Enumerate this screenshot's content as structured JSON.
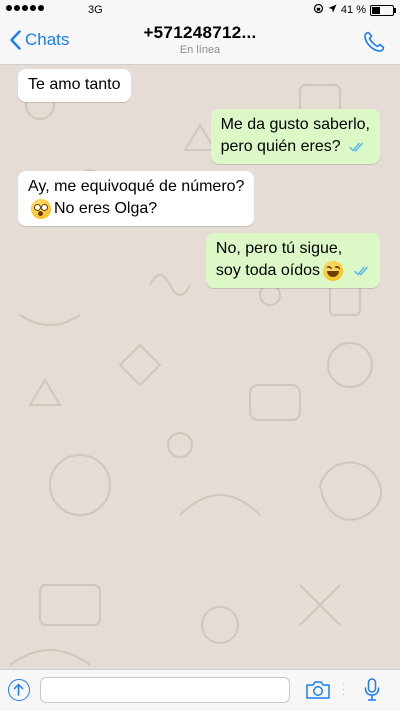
{
  "status_bar": {
    "carrier": "3G",
    "battery": "41 %",
    "battery_level": 0.41
  },
  "header": {
    "back_label": "Chats",
    "contact": "+571248712...",
    "contact_status": "En línea"
  },
  "messages": [
    {
      "direction": "in",
      "lines": [
        "Te amo tanto"
      ]
    },
    {
      "direction": "out",
      "lines": [
        "Me da gusto saberlo,",
        "pero quién eres?"
      ],
      "read": true
    },
    {
      "direction": "in",
      "lines": [
        "Ay, me equivoqué de número?",
        "No eres Olga?"
      ],
      "emoji": "flushed-face"
    },
    {
      "direction": "out",
      "lines": [
        "No, pero tú sigue,",
        "soy toda oídos"
      ],
      "emoji": "laughing-face",
      "read": true
    }
  ],
  "input": {
    "value": "",
    "placeholder": ""
  },
  "colors": {
    "accent": "#1a7cf6",
    "outgoing_bubble": "#dcf8c6",
    "incoming_bubble": "#ffffff",
    "chat_background": "#e5ddd5",
    "read_ticks": "#4fb6ec"
  },
  "icons": [
    "back-chevron-icon",
    "phone-icon",
    "share-icon",
    "camera-icon",
    "microphone-icon",
    "double-check-icon"
  ]
}
